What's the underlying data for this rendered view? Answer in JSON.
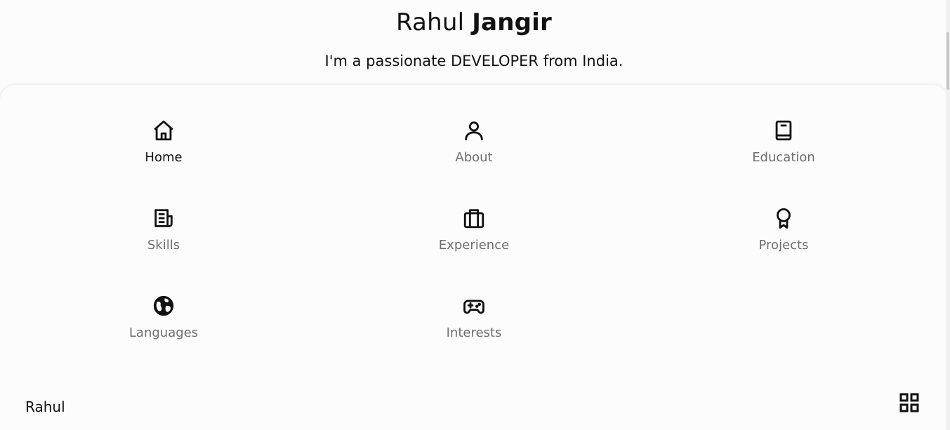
{
  "header": {
    "first_name": "Rahul",
    "last_name": "Jangir",
    "subtitle": "I'm a passionate DEVELOPER from India."
  },
  "menu": {
    "items": [
      {
        "label": "Home",
        "icon": "home-icon",
        "active": true
      },
      {
        "label": "About",
        "icon": "user-icon",
        "active": false
      },
      {
        "label": "Education",
        "icon": "book-icon",
        "active": false
      },
      {
        "label": "Skills",
        "icon": "newspaper-icon",
        "active": false
      },
      {
        "label": "Experience",
        "icon": "briefcase-icon",
        "active": false
      },
      {
        "label": "Projects",
        "icon": "award-icon",
        "active": false
      },
      {
        "label": "Languages",
        "icon": "globe-icon",
        "active": false
      },
      {
        "label": "Interests",
        "icon": "gamepad-icon",
        "active": false
      }
    ]
  },
  "footer": {
    "brand": "Rahul",
    "menu_toggle_icon": "grid-icon"
  },
  "colors": {
    "text_primary": "#111111",
    "text_muted": "#6e6e6e",
    "background": "#fcfcfc"
  }
}
